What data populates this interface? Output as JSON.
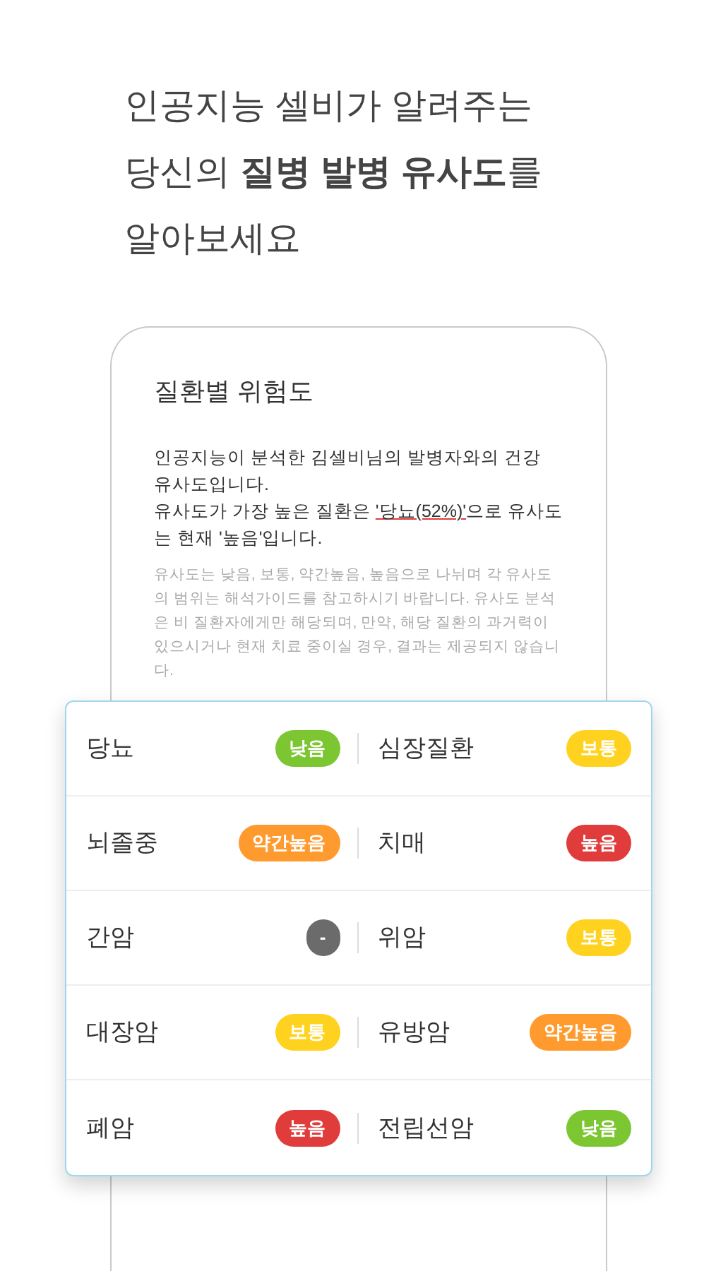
{
  "headline": [
    "인공지능 셀비가 알려주는",
    "당신의 **질병 발병 유사도**를",
    "알아보세요"
  ],
  "card": {
    "title": "질환별 위험도",
    "summary": {
      "line1": "인공지능이 분석한 김셀비님의 발병자와의 건강 유사도입니다.",
      "before": "유사도가 가장 높은 질환은 ",
      "highlight": "'당뇨(52%)'",
      "after": "으로 유사도는 현재 '높음'입니다."
    },
    "note": "유사도는 낮음, 보통, 약간높음, 높음으로 나뉘며 각 유사도의 범위는 해석가이드를 참고하시기 바랍니다. 유사도 분석은 비 질환자에게만 해당되며, 만약, 해당 질환의 과거력이 있으시거나 현재 치료 중이실 경우, 결과는 제공되지 않습니다."
  },
  "diseases": [
    {
      "name": "당뇨",
      "badge": "낮음",
      "kind": "low"
    },
    {
      "name": "심장질환",
      "badge": "보통",
      "kind": "medium"
    },
    {
      "name": "뇌졸중",
      "badge": "약간높음",
      "kind": "somewhat_high"
    },
    {
      "name": "치매",
      "badge": "높음",
      "kind": "high"
    },
    {
      "name": "간암",
      "badge": "-",
      "kind": "none"
    },
    {
      "name": "위암",
      "badge": "보통",
      "kind": "medium"
    },
    {
      "name": "대장암",
      "badge": "보통",
      "kind": "medium"
    },
    {
      "name": "유방암",
      "badge": "약간높음",
      "kind": "somewhat_high"
    },
    {
      "name": "폐암",
      "badge": "높음",
      "kind": "high"
    },
    {
      "name": "전립선암",
      "badge": "낮음",
      "kind": "low"
    }
  ]
}
